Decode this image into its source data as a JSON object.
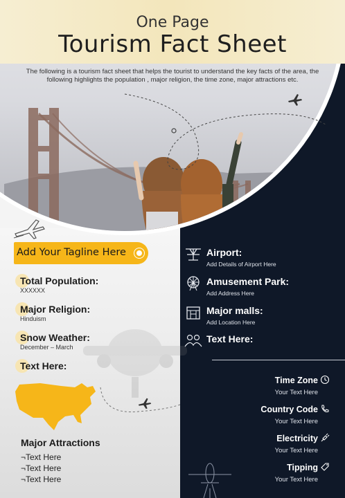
{
  "header": {
    "subtitle": "One Page",
    "title": "Tourism Fact Sheet",
    "intro": "The following is a tourism fact sheet that helps the tourist to understand the key facts of the area, the following highlights the population   , major religion, the time zone, major attractions etc."
  },
  "tagline": "Add Your Tagline Here",
  "facts": [
    {
      "label": "Total Population:",
      "value": "XXXXXX"
    },
    {
      "label": "Major Religion:",
      "value": "Hinduism"
    },
    {
      "label": "Snow Weather:",
      "value": "December – March"
    },
    {
      "label": "Text Here:",
      "value": ""
    }
  ],
  "attractions": {
    "title": "Major Attractions",
    "items": [
      "¬Text Here",
      "¬Text Here",
      "¬Text Here"
    ]
  },
  "right_items": [
    {
      "label": "Airport:",
      "value": "Add Details of Airport Here",
      "icon": "airport-icon"
    },
    {
      "label": "Amusement Park:",
      "value": "Add Address Here",
      "icon": "ferris-wheel-icon"
    },
    {
      "label": "Major malls:",
      "value": "Add Location Here",
      "icon": "mall-icon"
    },
    {
      "label": "Text Here:",
      "value": "",
      "icon": "people-icon"
    }
  ],
  "stats": [
    {
      "label": "Time Zone",
      "value": "Your Text Here",
      "icon": "clock-icon"
    },
    {
      "label": "Country Code",
      "value": "Your Text Here",
      "icon": "phone-icon"
    },
    {
      "label": "Electricity",
      "value": "Your Text Here",
      "icon": "plug-icon"
    },
    {
      "label": "Tipping",
      "value": "Your Text Here",
      "icon": "tag-icon"
    }
  ],
  "colors": {
    "accent": "#f6b619",
    "dark": "#0f1828",
    "header": "#f3e6bb"
  }
}
